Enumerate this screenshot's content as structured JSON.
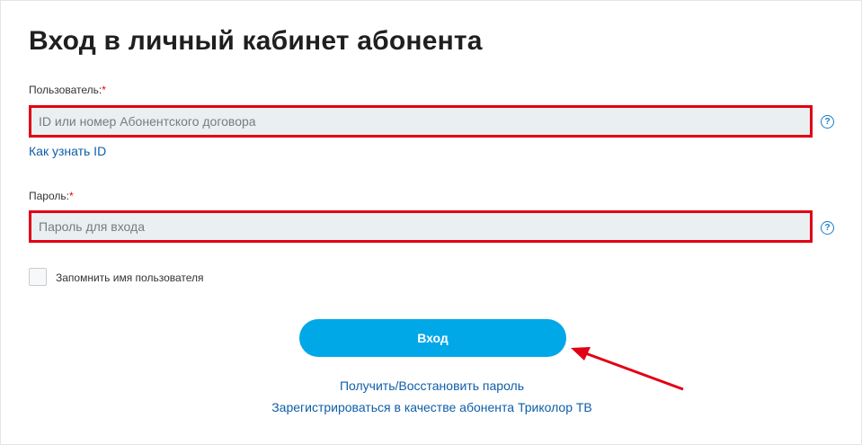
{
  "page": {
    "title": "Вход в личный кабинет абонента"
  },
  "username": {
    "label": "Пользователь:",
    "required_mark": "*",
    "placeholder": "ID или номер Абонентского договора",
    "value": "",
    "help_icon": "question-circle-icon",
    "how_link": "Как узнать ID"
  },
  "password": {
    "label": "Пароль:",
    "required_mark": "*",
    "placeholder": "Пароль для входа",
    "value": "",
    "help_icon": "question-circle-icon"
  },
  "remember": {
    "label": "Запомнить имя пользователя",
    "checked": false
  },
  "login_button": {
    "label": "Вход"
  },
  "links": {
    "recover": "Получить/Восстановить пароль",
    "register": "Зарегистрироваться в качестве абонента Триколор ТВ"
  },
  "colors": {
    "accent": "#00a8e8",
    "highlight": "#e10014",
    "link": "#0e5ea8",
    "input_bg": "#eaf0f1"
  }
}
